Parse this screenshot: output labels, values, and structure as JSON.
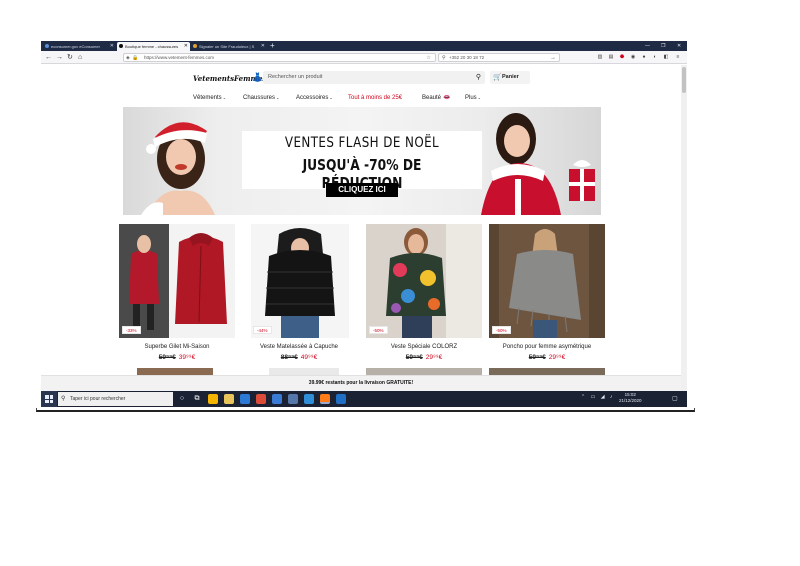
{
  "browser": {
    "tabs": [
      {
        "label": "econsumer.gov eConsumer",
        "active": false
      },
      {
        "label": "Boutique femme - chaussures",
        "active": true
      },
      {
        "label": "Signaler un Site Frauduleux | S",
        "active": false
      }
    ],
    "url": "https://www.vetement-femmes.com",
    "search_value": "+352 20 30 18 72"
  },
  "site": {
    "logo": "VetementsFemmes",
    "search_placeholder": "Rechercher un produit",
    "cart_label": "Panier",
    "nav": [
      {
        "label": "Vêtements",
        "chevron": true,
        "highlight": false
      },
      {
        "label": "Chaussures",
        "chevron": true,
        "highlight": false
      },
      {
        "label": "Accessoires",
        "chevron": true,
        "highlight": false
      },
      {
        "label": "Tout à moins de 25€",
        "chevron": false,
        "highlight": true
      },
      {
        "label": "Beauté",
        "chevron": false,
        "highlight": false
      },
      {
        "label": "Plus",
        "chevron": true,
        "highlight": false
      }
    ],
    "banner": {
      "line1": "VENTES FLASH DE NOËL",
      "line2": "JUSQU'À -70% DE RÉDUCTION",
      "cta": "CLIQUEZ ICI"
    },
    "products": [
      {
        "name": "Superbe Gilet Mi-Saison",
        "discount": "-33%",
        "old_price": "59⁹⁹€",
        "new_price": "39⁹⁹€"
      },
      {
        "name": "Veste Matelassée à Capuche",
        "discount": "-44%",
        "old_price": "88⁹⁹€",
        "new_price": "49⁹⁹€"
      },
      {
        "name": "Veste Spéciale COLORZ",
        "discount": "-50%",
        "old_price": "59⁹⁹€",
        "new_price": "29⁹⁹€"
      },
      {
        "name": "Poncho pour femme asymétrique",
        "discount": "-50%",
        "old_price": "59⁹⁹€",
        "new_price": "29⁹⁹€"
      }
    ],
    "free_shipping": "39.99€ restants pour la livraison GRATUITE!"
  },
  "taskbar": {
    "search_placeholder": "Taper ici pour rechercher",
    "time": "15:02",
    "date": "21/12/2020"
  },
  "colors": {
    "accent_red": "#d0021b",
    "tabbar": "#1f2a44",
    "taskbar": "#1a2233"
  }
}
